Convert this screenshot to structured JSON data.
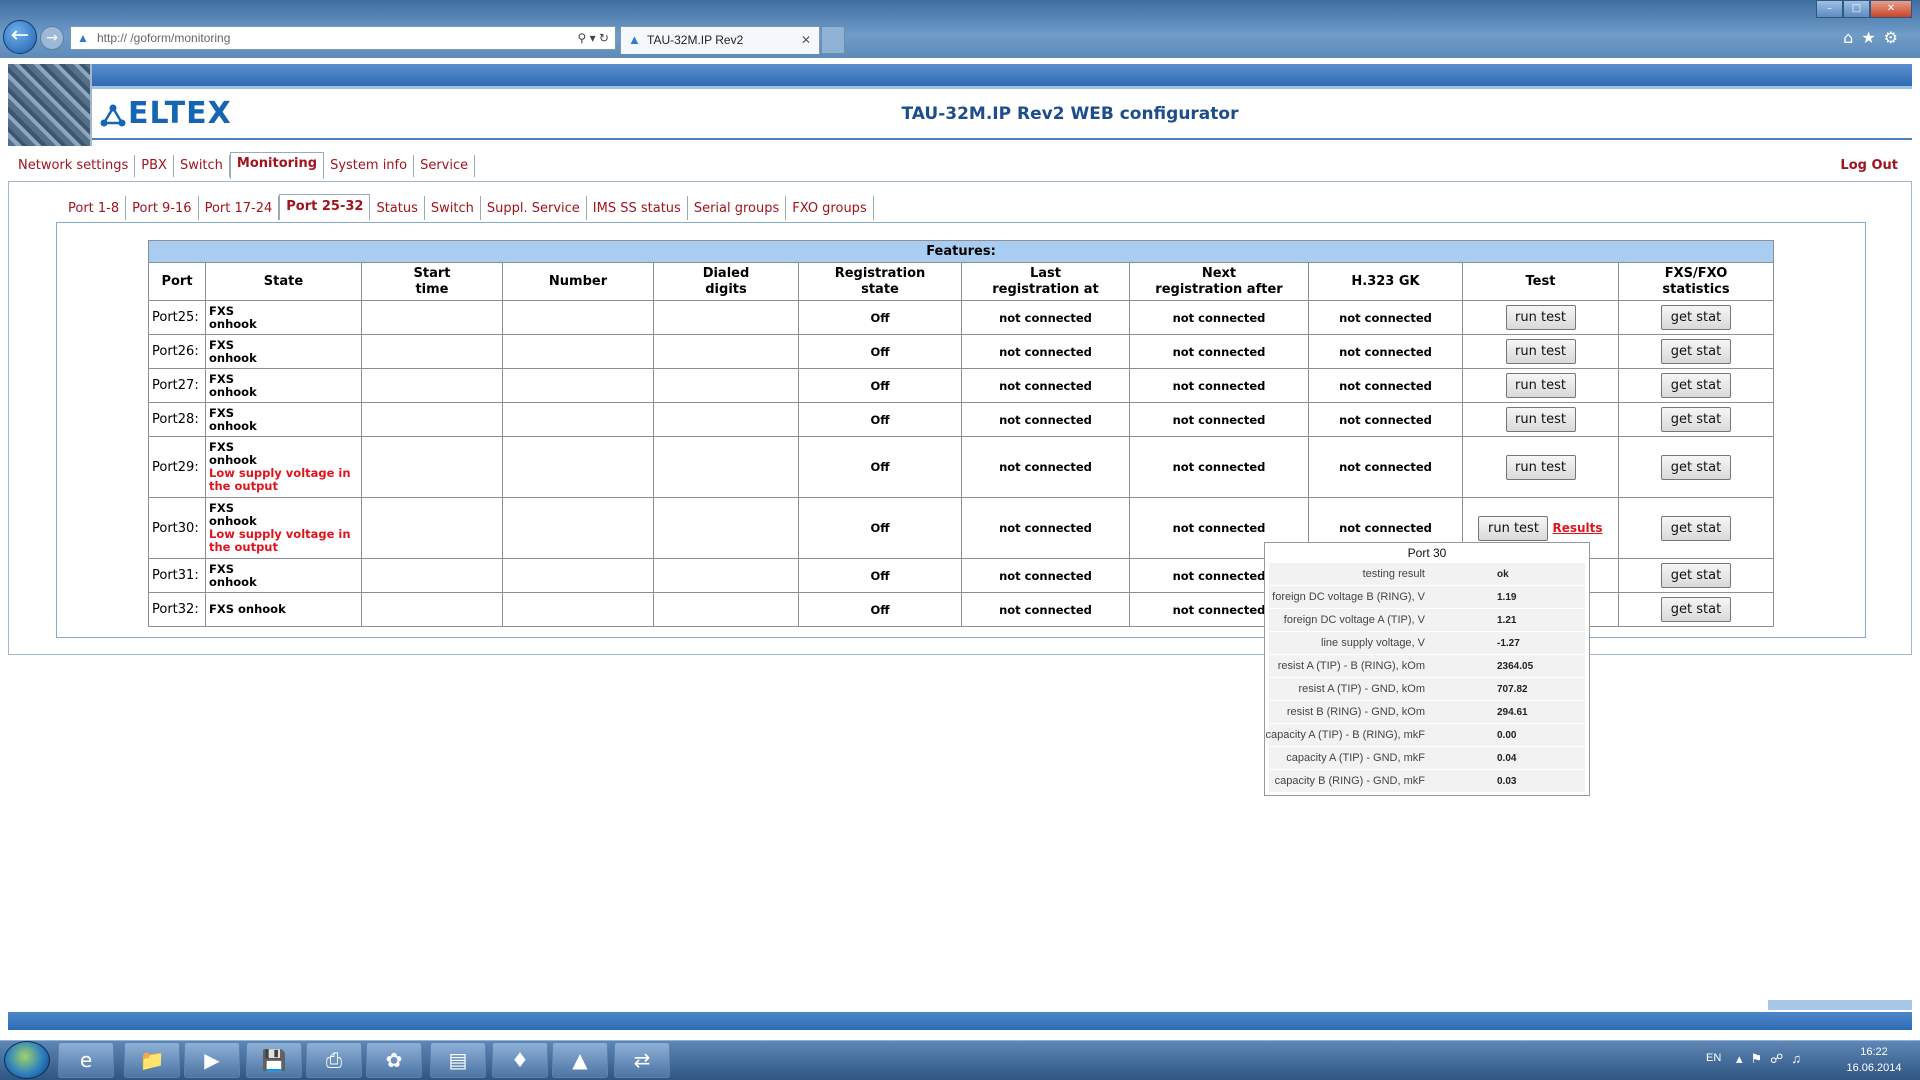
{
  "browser": {
    "address": "http://            /goform/monitoring",
    "tab_title": "TAU-32M.IP Rev2"
  },
  "header": {
    "logo": "ELTEX",
    "title": "TAU-32M.IP Rev2 WEB configurator"
  },
  "main_nav": {
    "items": [
      "Network settings",
      "PBX",
      "Switch",
      "Monitoring",
      "System info",
      "Service"
    ],
    "active": "Monitoring",
    "logout": "Log Out"
  },
  "sub_nav": {
    "items": [
      "Port 1-8",
      "Port 9-16",
      "Port 17-24",
      "Port 25-32",
      "Status",
      "Switch",
      "Suppl. Service",
      "IMS SS status",
      "Serial groups",
      "FXO groups"
    ],
    "active": "Port 25-32"
  },
  "table": {
    "caption": "Features:",
    "headers": [
      "Port",
      "State",
      "Start time",
      "Number",
      "Dialed digits",
      "Registration state",
      "Last registration at",
      "Next registration after",
      "H.323 GK",
      "Test",
      "FXS/FXO statistics"
    ],
    "rows": [
      {
        "port": "Port25:",
        "state1": "FXS",
        "state2": "onhook",
        "warn": "",
        "reg": "Off",
        "last": "not connected",
        "next": "not connected",
        "gk": "not connected",
        "test": "run test",
        "stat": "get stat"
      },
      {
        "port": "Port26:",
        "state1": "FXS",
        "state2": "onhook",
        "warn": "",
        "reg": "Off",
        "last": "not connected",
        "next": "not connected",
        "gk": "not connected",
        "test": "run test",
        "stat": "get stat"
      },
      {
        "port": "Port27:",
        "state1": "FXS",
        "state2": "onhook",
        "warn": "",
        "reg": "Off",
        "last": "not connected",
        "next": "not connected",
        "gk": "not connected",
        "test": "run test",
        "stat": "get stat"
      },
      {
        "port": "Port28:",
        "state1": "FXS",
        "state2": "onhook",
        "warn": "",
        "reg": "Off",
        "last": "not connected",
        "next": "not connected",
        "gk": "not connected",
        "test": "run test",
        "stat": "get stat"
      },
      {
        "port": "Port29:",
        "state1": "FXS",
        "state2": "onhook",
        "warn": "Low supply voltage in the output",
        "reg": "Off",
        "last": "not connected",
        "next": "not connected",
        "gk": "not connected",
        "test": "run test",
        "stat": "get stat"
      },
      {
        "port": "Port30:",
        "state1": "FXS",
        "state2": "onhook",
        "warn": "Low supply voltage in the output",
        "reg": "Off",
        "last": "not connected",
        "next": "not connected",
        "gk": "not connected",
        "test": "run test",
        "results": "Results",
        "stat": "get stat"
      },
      {
        "port": "Port31:",
        "state1": "FXS",
        "state2": "onhook",
        "warn": "",
        "reg": "Off",
        "last": "not connected",
        "next": "not connected",
        "gk": "",
        "test": "",
        "stat": "get stat"
      },
      {
        "port": "Port32:",
        "state1": "FXS onhook",
        "state2": "",
        "warn": "",
        "reg": "Off",
        "last": "not connected",
        "next": "not connected",
        "gk": "",
        "test": "",
        "stat": "get stat"
      }
    ]
  },
  "popup": {
    "title": "Port 30",
    "rows": [
      {
        "k": "testing result",
        "v": "ok"
      },
      {
        "k": "foreign DC voltage B (RING), V",
        "v": "1.19"
      },
      {
        "k": "foreign DC voltage A (TIP), V",
        "v": "1.21"
      },
      {
        "k": "line supply voltage, V",
        "v": "-1.27"
      },
      {
        "k": "resist A (TIP) - B (RING), kOm",
        "v": "2364.05"
      },
      {
        "k": "resist A (TIP) - GND, kOm",
        "v": "707.82"
      },
      {
        "k": "resist B (RING) - GND, kOm",
        "v": "294.61"
      },
      {
        "k": "capacity A (TIP) - B (RING), mkF",
        "v": "0.00"
      },
      {
        "k": "capacity A (TIP) - GND, mkF",
        "v": "0.04"
      },
      {
        "k": "capacity B (RING) - GND, mkF",
        "v": "0.03"
      }
    ]
  },
  "taskbar": {
    "lang": "EN",
    "time": "16:22",
    "date": "16.06.2014"
  }
}
